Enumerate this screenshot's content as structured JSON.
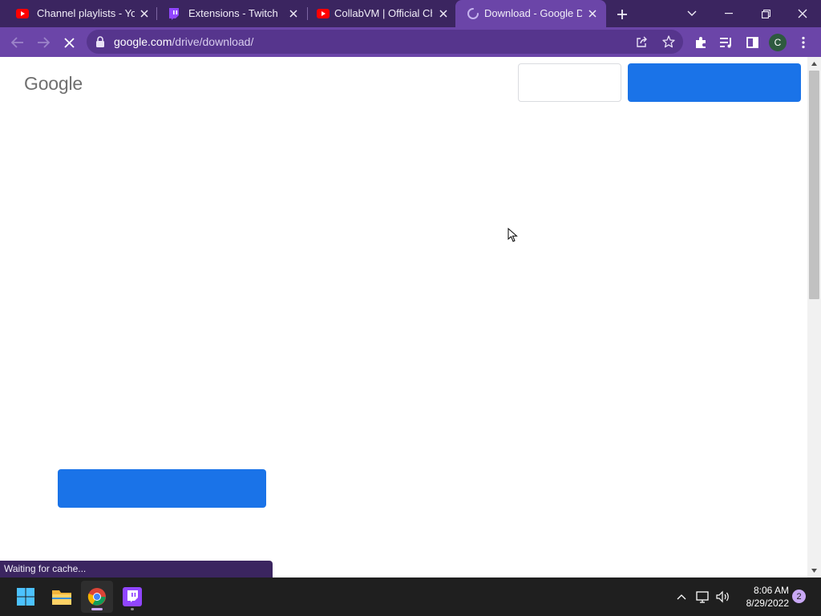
{
  "tabs": [
    {
      "title": "Channel playlists - YouT",
      "icon": "youtube-icon"
    },
    {
      "title": "Extensions - Twitch",
      "icon": "twitch-icon"
    },
    {
      "title": "CollabVM | Official Cha",
      "icon": "youtube-icon"
    },
    {
      "title": "Download - Google Dri",
      "icon": "loading-spinner-icon",
      "active": true
    }
  ],
  "address_bar": {
    "domain": "google.com",
    "path": "/drive/download/"
  },
  "page": {
    "logo_text": "Google"
  },
  "status_bubble": {
    "text": "Waiting for cache..."
  },
  "taskbar": {
    "apps": [
      "start-icon",
      "file-explorer-icon",
      "chrome-icon",
      "twitch-icon"
    ],
    "time": "8:06 AM",
    "date": "8/29/2022",
    "notification_count": "2"
  },
  "colors": {
    "tabstrip": "#3b2560",
    "toolbar": "#6b45a8",
    "google_blue": "#1a73e8",
    "taskbar": "#1f1f1f"
  }
}
